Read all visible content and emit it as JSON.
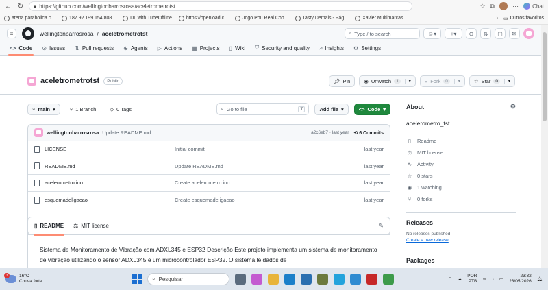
{
  "browser": {
    "url": "https://github.com/wellingtonbarrosrosa/aceletrometrotst",
    "chat_label": "Chat"
  },
  "bookmarks": {
    "items": [
      "atena parabolica c...",
      "187.92.199.154:808...",
      "DL with TubeOffline",
      "https://openload.c...",
      "Jogo Pou Real Coo...",
      "Tasty Demais - Pág...",
      "Xavier Multimarcas"
    ],
    "other": "Outros favoritos"
  },
  "gh": {
    "owner": "wellingtonbarrosrosa",
    "sep": "/",
    "repo": "aceletrometrotst",
    "search_placeholder": "Type / to search",
    "search_key": "/",
    "tabs": [
      "Code",
      "Issues",
      "Pull requests",
      "Agents",
      "Actions",
      "Projects",
      "Wiki",
      "Security and quality",
      "Insights",
      "Settings"
    ]
  },
  "repo": {
    "name": "aceletrometrotst",
    "visibility": "Public",
    "pin": "Pin",
    "unwatch": "Unwatch",
    "unwatch_count": "1",
    "fork": "Fork",
    "fork_count": "0",
    "star": "Star",
    "star_count": "0"
  },
  "filebar": {
    "branch": "main",
    "branches": "1 Branch",
    "tags": "0 Tags",
    "goto": "Go to file",
    "goto_key": "T",
    "add_file": "Add file",
    "code": "Code"
  },
  "commit": {
    "author": "wellingtonbarrosrosa",
    "message": "Update README.md",
    "hash": "a2c6eb7 · last year",
    "count": "6 Commits"
  },
  "files": [
    {
      "name": "LICENSE",
      "commit": "Initial commit",
      "date": "last year"
    },
    {
      "name": "README.md",
      "commit": "Update README.md",
      "date": "last year"
    },
    {
      "name": "acelerometro.ino",
      "commit": "Create acelerometro.ino",
      "date": "last year"
    },
    {
      "name": "esquemadeligacao",
      "commit": "Create esquemadeligacao",
      "date": "last year"
    }
  ],
  "readme": {
    "tab_readme": "README",
    "tab_license": "MIT license",
    "text": "Sistema de Monitoramento de Vibração com ADXL345 e ESP32 Descrição Este projeto implementa um sistema de monitoramento de vibração utilizando o sensor ADXL345 e um microcontrolador ESP32. O sistema lê dados de"
  },
  "about": {
    "title": "About",
    "description": "acelerometro_tst",
    "items": [
      "Readme",
      "MIT license",
      "Activity",
      "0 stars",
      "1 watching",
      "0 forks"
    ],
    "releases_title": "Releases",
    "releases_none": "No releases published",
    "releases_link": "Create a new release",
    "packages_title": "Packages"
  },
  "taskbar": {
    "temp": "16°C",
    "weather": "Chuva forte",
    "badge": "3",
    "search": "Pesquisar",
    "lang1": "POR",
    "lang2": "PTB",
    "time": "23:32",
    "date": "23/05/2026"
  }
}
